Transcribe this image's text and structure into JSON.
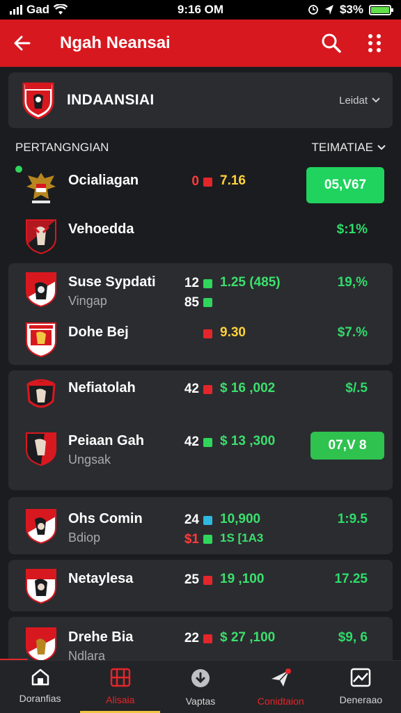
{
  "status": {
    "carrier": "Gad",
    "time": "9:16 OM",
    "battery": "$3%"
  },
  "appbar": {
    "title": "Ngah Neansai"
  },
  "team": {
    "name": "INDAANSIAI",
    "filter_label": "Leidat"
  },
  "section": {
    "title": "PERTANGNGIAN",
    "sort_label": "TEIMATIAE"
  },
  "rows": [
    {
      "name": "Ocialiagan",
      "num": "0",
      "num_color": "#ff3b3b",
      "sq": "r",
      "val": "7.16",
      "val_color": "#ffd23a",
      "pill": "05,V67"
    },
    {
      "name": "Vehoedda",
      "pct": "$:1%"
    },
    {
      "name": "Suse Sypdati",
      "sub": "Vingap",
      "num": "12",
      "sq": "g",
      "val": "1.25 (485)",
      "num2": "85",
      "sq2": "g",
      "pct": "19,%"
    },
    {
      "name": "Dohe Bej",
      "sq": "r",
      "val": "9.30",
      "pct": "$7.%"
    },
    {
      "name": "Nefiatolah",
      "num": "42",
      "sq": "r",
      "val": "$ 16 ,002",
      "pct": "$/.5"
    },
    {
      "name": "Peiaan Gah",
      "sub": "Ungsak",
      "num": "42",
      "sq": "g",
      "val": "$ 13 ,300",
      "pill": "07,V 8"
    },
    {
      "name": "Ohs Comin",
      "sub": "Bdiop",
      "num": "24",
      "sq": "b",
      "val": "10,900",
      "num2": "$1",
      "sq2": "g",
      "val2": "1S [1A3",
      "pct": "1:9.5"
    },
    {
      "name": "Netaylesa",
      "num": "25",
      "sq": "r",
      "val": "19 ,100",
      "pct": "17.25"
    },
    {
      "name": "Drehe Bia",
      "sub": "Ndlara",
      "num": "22",
      "sq": "r",
      "val": "$ 27 ,100",
      "pct": "$9, 6"
    }
  ],
  "nav": [
    {
      "label": "Doranfias",
      "icon": "home-icon"
    },
    {
      "label": "Alisaia",
      "icon": "grid-icon",
      "active": true
    },
    {
      "label": "Vaptas",
      "icon": "download-icon"
    },
    {
      "label": "Conidtaion",
      "icon": "plane-icon"
    },
    {
      "label": "Deneraao",
      "icon": "chart-icon"
    }
  ]
}
